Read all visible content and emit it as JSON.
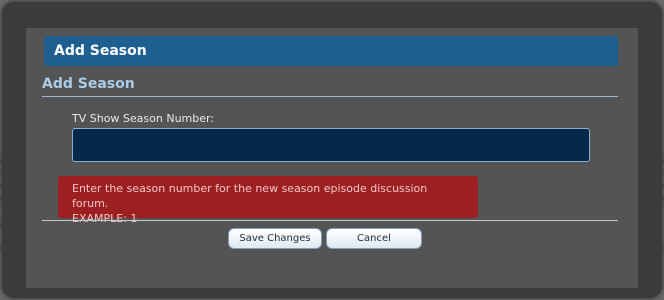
{
  "dialog": {
    "title": "Add Season",
    "section_heading": "Add Season",
    "field": {
      "label": "TV Show Season Number:",
      "value": "",
      "placeholder": ""
    },
    "error": {
      "line1": "Enter the season number for the new season episode discussion forum.",
      "line2": "EXAMPLE: 1"
    },
    "buttons": {
      "save": "Save Changes",
      "cancel": "Cancel"
    }
  },
  "colors": {
    "title_bar": "#1e5f92",
    "section_heading": "#a9cce8",
    "input_background": "#06284a",
    "error_background": "#9c1f22",
    "error_text": "#f4c5c5"
  }
}
